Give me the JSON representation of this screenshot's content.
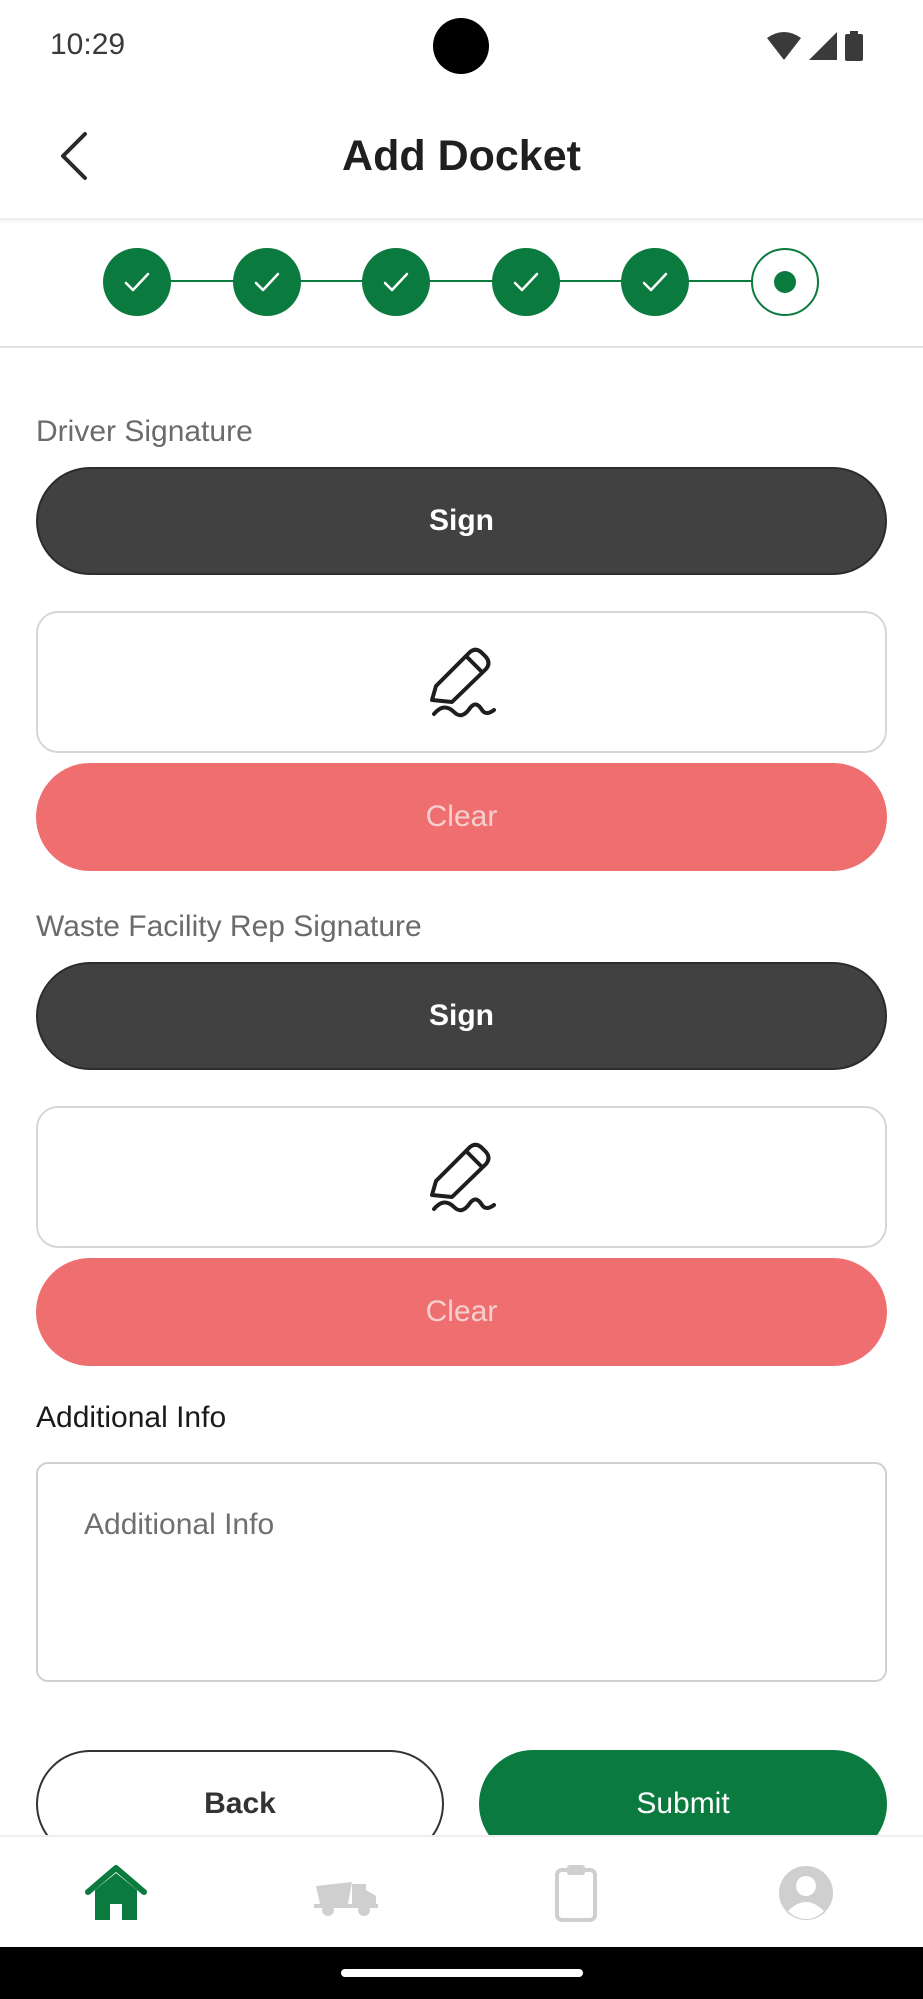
{
  "status_bar": {
    "time": "10:29"
  },
  "header": {
    "title": "Add Docket",
    "back_icon": "chevron-left-icon"
  },
  "stepper": {
    "total_steps": 6,
    "completed_steps": 5,
    "current_step": 6,
    "accent_color": "#0b7a3e"
  },
  "driver_signature": {
    "label": "Driver Signature",
    "sign_label": "Sign",
    "pad_icon": "signature-pen-icon",
    "clear_label": "Clear"
  },
  "facility_signature": {
    "label": "Waste Facility Rep Signature",
    "sign_label": "Sign",
    "pad_icon": "signature-pen-icon",
    "clear_label": "Clear"
  },
  "additional_info": {
    "label": "Additional Info",
    "placeholder": "Additional Info",
    "value": ""
  },
  "actions": {
    "back_label": "Back",
    "submit_label": "Submit"
  },
  "bottom_nav": {
    "items": [
      {
        "icon": "home-icon",
        "active": true
      },
      {
        "icon": "skip-truck-icon",
        "active": false
      },
      {
        "icon": "clipboard-icon",
        "active": false
      },
      {
        "icon": "profile-icon",
        "active": false
      }
    ]
  },
  "colors": {
    "primary_green": "#0b7a3e",
    "sign_button": "#414141",
    "clear_button": "#ef6f70",
    "inactive_icon": "#cfcfcf"
  }
}
